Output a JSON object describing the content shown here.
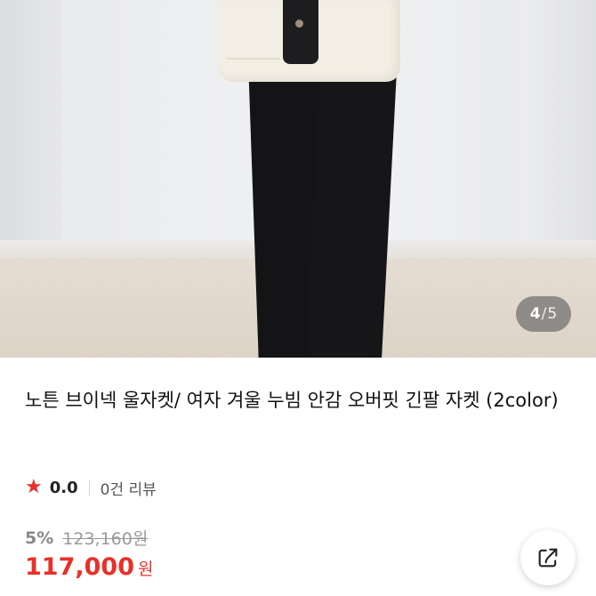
{
  "gallery": {
    "current_index": "4",
    "separator": "/",
    "total": "5"
  },
  "product": {
    "title": "노튼 브이넥 울자켓/ 여자 겨울 누빔 안감 오버핏 긴팔 자켓 (2color)",
    "rating": {
      "star_icon": "star-icon",
      "value": "0.0",
      "reviews": "0건 리뷰"
    },
    "price": {
      "discount": "5%",
      "original": "123,160원",
      "sale": "117,000",
      "currency": "원"
    }
  },
  "actions": {
    "share_icon": "share-icon"
  },
  "colors": {
    "accent": "#e8302a",
    "muted": "#9a9a9a"
  }
}
